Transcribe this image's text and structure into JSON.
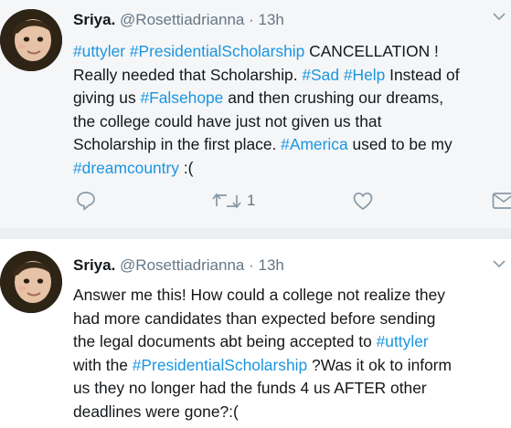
{
  "tweets": [
    {
      "name": "Sriya.",
      "handle": "@Rosettiadrianna",
      "sep": " · ",
      "time": "13h",
      "lines": [
        [
          {
            "t": "#uttyler",
            "tag": true
          },
          {
            "t": " ",
            "tag": false
          },
          {
            "t": "#PresidentialScholarship",
            "tag": true
          },
          {
            "t": " CANCELLATION !",
            "tag": false
          }
        ],
        [
          {
            "t": "Really needed that Scholarship. ",
            "tag": false
          },
          {
            "t": "#Sad",
            "tag": true
          },
          {
            "t": " ",
            "tag": false
          },
          {
            "t": "#Help",
            "tag": true
          },
          {
            "t": " Instead of",
            "tag": false
          }
        ],
        [
          {
            "t": "giving us ",
            "tag": false
          },
          {
            "t": "#Falsehope",
            "tag": true
          },
          {
            "t": " and then crushing our dreams,",
            "tag": false
          }
        ],
        [
          {
            "t": "the college could have just not given us that",
            "tag": false
          }
        ],
        [
          {
            "t": "Scholarship in the first place. ",
            "tag": false
          },
          {
            "t": "#America",
            "tag": true
          },
          {
            "t": " used to be my",
            "tag": false
          }
        ],
        [
          {
            "t": "#dreamcountry",
            "tag": true
          },
          {
            "t": " :(",
            "tag": false
          }
        ]
      ],
      "retweet_count": "1"
    },
    {
      "name": "Sriya.",
      "handle": "@Rosettiadrianna",
      "sep": " · ",
      "time": "13h",
      "lines": [
        [
          {
            "t": "Answer me this! How could a college not realize they",
            "tag": false
          }
        ],
        [
          {
            "t": "had more candidates than expected before sending",
            "tag": false
          }
        ],
        [
          {
            "t": "the legal documents abt being accepted to ",
            "tag": false
          },
          {
            "t": "#uttyler",
            "tag": true
          }
        ],
        [
          {
            "t": "with the ",
            "tag": false
          },
          {
            "t": "#PresidentialScholarship",
            "tag": true
          },
          {
            "t": " ?Was it ok to inform",
            "tag": false
          }
        ],
        [
          {
            "t": "us they no longer had the funds 4 us AFTER other",
            "tag": false
          }
        ],
        [
          {
            "t": "deadlines were gone?:(",
            "tag": false
          }
        ]
      ]
    }
  ],
  "icons": {
    "reply": "reply-icon",
    "retweet": "retweet-icon",
    "like": "heart-icon",
    "message": "envelope-icon",
    "more": "chevron-down-icon",
    "avatar": "avatar"
  },
  "colors": {
    "hashtag": "#1b95e0",
    "text": "#14171a",
    "secondary": "#657786",
    "tweet1_bg": "#f5f6f7",
    "divider": "#eceff2"
  }
}
